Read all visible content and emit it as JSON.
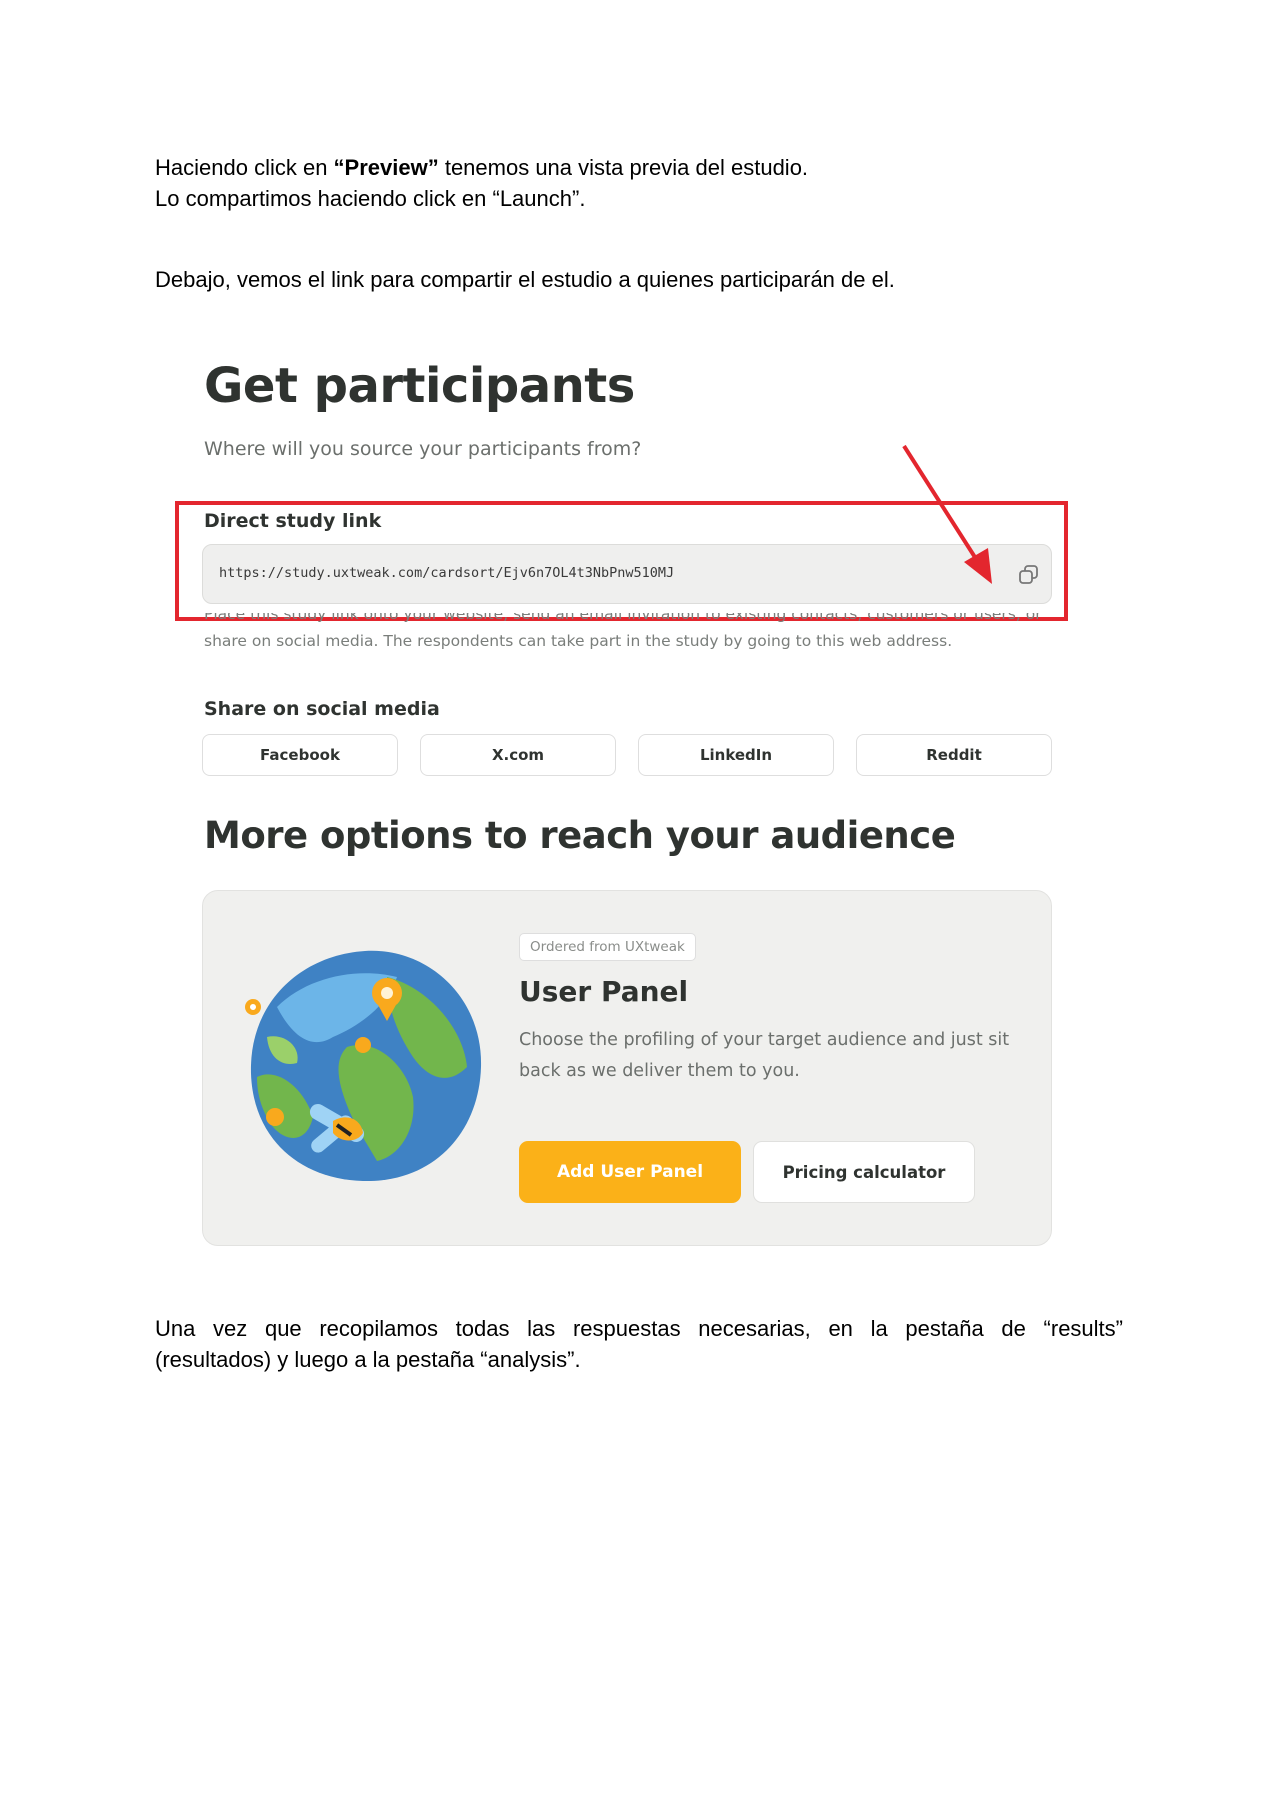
{
  "intro": {
    "line1_part1": "Haciendo click en ",
    "line1_bold": "“Preview”",
    "line1_part2": " tenemos una vista previa del estudio.",
    "line2": "Lo compartimos haciendo click en “Launch”.",
    "line3": "Debajo, vemos el link para compartir el estudio a quienes participarán de el."
  },
  "screenshot": {
    "title": "Get participants",
    "subtitle": "Where will you source your participants from?",
    "direct_link_label": "Direct study link",
    "study_url": "https://study.uxtweak.com/cardsort/Ejv6n7OL4t3NbPnw510MJ",
    "help_text": "Place this study link onto your website, send an email invitation to existing contacts, customers or users, or share on social media. The respondents can take part in the study by going to this web address.",
    "share_label": "Share on social media",
    "social_buttons": [
      "Facebook",
      "X.com",
      "LinkedIn",
      "Reddit"
    ],
    "more_title": "More options to reach your audience",
    "card": {
      "badge": "Ordered from UXtweak",
      "title": "User Panel",
      "description": "Choose the profiling of your target audience and just sit back as we deliver them to you.",
      "primary_button": "Add User Panel",
      "secondary_button": "Pricing calculator"
    },
    "colors": {
      "accent": "#fbb118",
      "highlight_box": "#e3262e",
      "arrow": "#e3262e"
    }
  },
  "outro": {
    "line1": "Una vez que recopilamos todas las respuestas necesarias, en la pestaña de “results”",
    "line2": "(resultados) y luego a la pestaña “analysis”."
  }
}
